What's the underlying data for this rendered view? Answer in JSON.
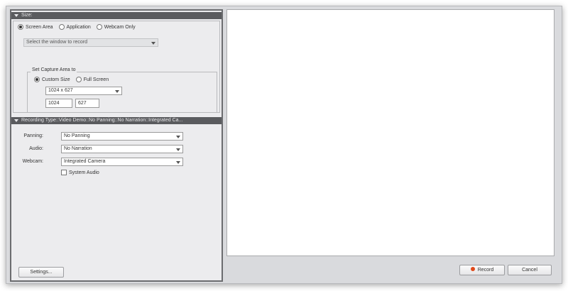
{
  "size_panel": {
    "header": "Size:",
    "source_options": [
      {
        "label": "Screen Area",
        "checked": true
      },
      {
        "label": "Application",
        "checked": false
      },
      {
        "label": "Webcam Only",
        "checked": false
      }
    ],
    "window_select": {
      "value": "Select the window to record",
      "disabled": true
    },
    "capture_area": {
      "legend": "Set Capture Area to",
      "options": [
        {
          "label": "Custom Size",
          "checked": true
        },
        {
          "label": "Full Screen",
          "checked": false
        }
      ],
      "size_select": {
        "value": "1024 x 627"
      },
      "width": "1024",
      "height": "627"
    }
  },
  "recording_panel": {
    "header": "Recording Type::Video Demo::No Panning::No Narration::Integrated Ca...",
    "panning": {
      "label": "Panning:",
      "value": "No Panning"
    },
    "audio": {
      "label": "Audio:",
      "value": "No Narration"
    },
    "webcam": {
      "label": "Webcam:",
      "value": "Integrated Camera"
    },
    "system_audio": {
      "label": "System Audio",
      "checked": false
    }
  },
  "buttons": {
    "settings": "Settings...",
    "record": "Record",
    "cancel": "Cancel"
  },
  "colors": {
    "record_dot": "#e04a1b",
    "header_bg": "#5a5b5e"
  }
}
